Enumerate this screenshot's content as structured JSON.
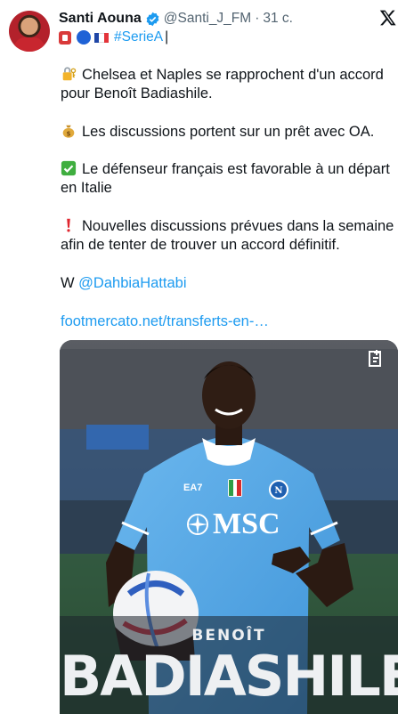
{
  "author": {
    "name": "Santi Aouna",
    "handle": "@Santi_J_FM",
    "separator": "·",
    "time": "31 c."
  },
  "bio": {
    "hashtag": "#SerieA",
    "cursor": "|"
  },
  "tweet": {
    "p1": "Chelsea et Naples se rapprochent d'un accord pour Benoît Badiashile.",
    "p2": "Les discussions portent sur un prêt avec OA.",
    "p3": "Le défenseur français est favorable à un départ en Italie",
    "p4": "Nouvelles discussions prévues dans la semaine afin de tenter de trouver un accord définitif.",
    "p5_prefix": "W",
    "mention": "@DahbiaHattabi",
    "link": "footmercato.net/transferts-en-…"
  },
  "media": {
    "kit_brand": "EA7",
    "sponsor": "MSC",
    "player_first_name": "BENOÎT",
    "player_last_name": "BADIASHILE"
  },
  "icons": {
    "verified": "verified-badge-icon",
    "x_logo": "x-logo-icon",
    "lock_key": "lock-key-emoji",
    "money_bag": "money-bag-emoji",
    "check": "check-mark-emoji",
    "exclamation": "exclamation-emoji",
    "media_tag": "media-tag-icon"
  },
  "colors": {
    "link": "#1d9bf0",
    "text": "#0f1419",
    "muted": "#536471",
    "kit": "#5aa9e6"
  }
}
